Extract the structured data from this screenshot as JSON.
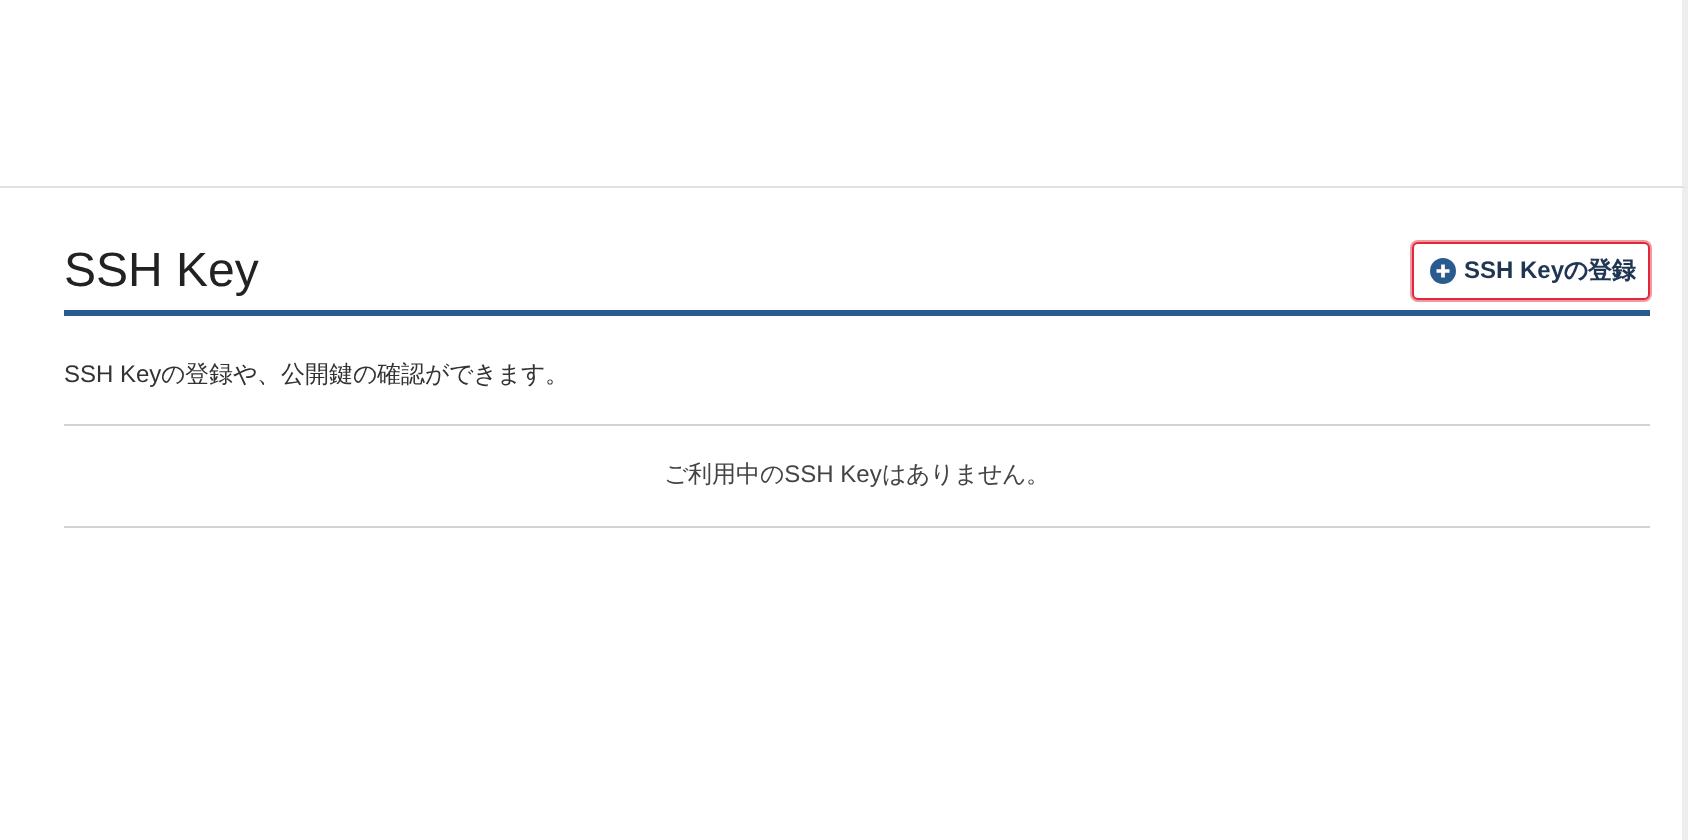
{
  "page": {
    "title": "SSH Key",
    "add_button": {
      "label": "SSH Keyの登録",
      "highlighted": true
    }
  },
  "description": "SSH Keyの登録や、公開鍵の確認ができます。",
  "empty_message": "ご利用中のSSH Keyはありません。"
}
